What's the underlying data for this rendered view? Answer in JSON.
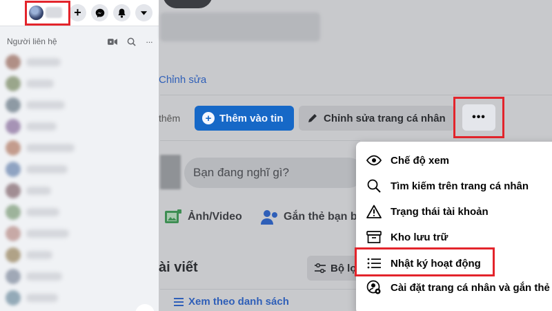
{
  "sidebar": {
    "contacts_title": "Người liên hệ",
    "contact_avatar_colors": [
      "#b08f86",
      "#9aa68b",
      "#8e9aa4",
      "#a693b5",
      "#c39c8d",
      "#8fa3c2",
      "#a18d93",
      "#9db39b",
      "#c7a9a6",
      "#b0a287",
      "#a0a8b6",
      "#94aab8"
    ]
  },
  "profile": {
    "edit_link": "Chỉnh sửa",
    "them_partial": "thêm",
    "add_story_label": "Thêm vào tin",
    "edit_profile_label": "Chỉnh sửa trang cá nhân",
    "more_label": "•••",
    "composer_placeholder": "Bạn đang nghĩ gì?",
    "photo_video_label": "Ảnh/Video",
    "tag_friends_label": "Gắn thẻ bạn bè",
    "posts_heading": "ài viết",
    "filter_label": "Bộ lọc",
    "list_view_label": "Xem theo danh sách"
  },
  "dropdown": {
    "items": [
      {
        "label": "Chế độ xem",
        "icon": "eye-icon"
      },
      {
        "label": "Tìm kiếm trên trang cá nhân",
        "icon": "search-icon"
      },
      {
        "label": "Trạng thái tài khoản",
        "icon": "warning-icon"
      },
      {
        "label": "Kho lưu trữ",
        "icon": "archive-icon"
      },
      {
        "label": "Nhật ký hoạt động",
        "icon": "list-icon"
      },
      {
        "label": "Cài đặt trang cá nhân và gắn thẻ",
        "icon": "profile-settings-icon"
      }
    ]
  },
  "colors": {
    "highlight_red": "#e3242b",
    "primary_blue": "#1668c7",
    "link_blue": "#2f5fb8"
  }
}
